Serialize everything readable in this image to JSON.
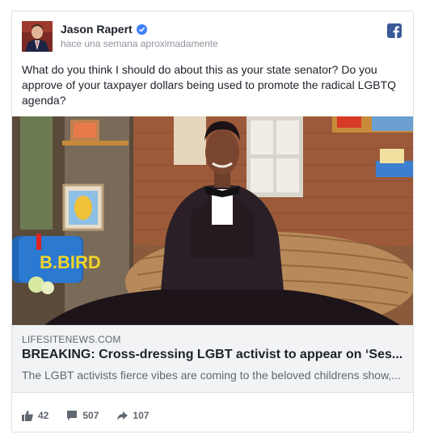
{
  "post": {
    "author": "Jason Rapert",
    "timestamp": "hace una semana aproximadamente",
    "text": "What do you think I should do about this as your state senator? Do you approve of your taxpayer dollars being used to promote the radical LGBTQ agenda?",
    "platform_icon": "facebook-icon",
    "verified_icon": "verified-badge-icon"
  },
  "link": {
    "domain": "LIFESITENEWS.COM",
    "title": "BREAKING: Cross-dressing LGBT activist to appear on ‘Ses...",
    "description": "The LGBT activists fierce vibes are coming to the beloved childrens show,...",
    "photo_sign_text": "B.BIRD"
  },
  "stats": {
    "likes": "42",
    "comments": "507",
    "shares": "107"
  },
  "colors": {
    "facebook_blue": "#3b5998",
    "verified_blue": "#4080ff",
    "text_primary": "#1d2129",
    "text_secondary": "#606770"
  }
}
